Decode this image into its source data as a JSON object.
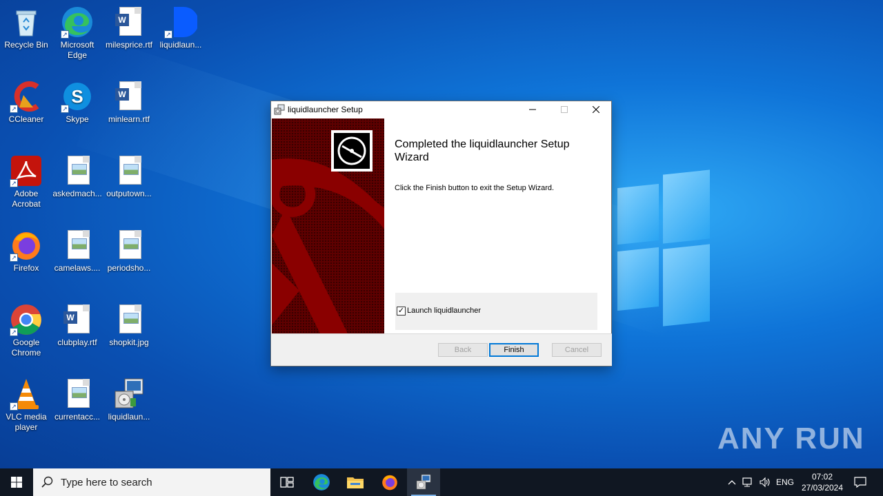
{
  "desktop": {
    "icons": [
      {
        "label": "Recycle Bin"
      },
      {
        "label": "Microsoft Edge"
      },
      {
        "label": "milesprice.rtf"
      },
      {
        "label": "liquidlaun..."
      },
      {
        "label": "CCleaner"
      },
      {
        "label": "Skype"
      },
      {
        "label": "minlearn.rtf"
      },
      {
        "label": "Adobe Acrobat"
      },
      {
        "label": "askedmach..."
      },
      {
        "label": "outputown..."
      },
      {
        "label": "Firefox"
      },
      {
        "label": "camelaws...."
      },
      {
        "label": "periodsho..."
      },
      {
        "label": "Google Chrome"
      },
      {
        "label": "clubplay.rtf"
      },
      {
        "label": "shopkit.jpg"
      },
      {
        "label": "VLC media player"
      },
      {
        "label": "currentacc..."
      },
      {
        "label": "liquidlaun..."
      }
    ]
  },
  "dialog": {
    "title": "liquidlauncher Setup",
    "heading": "Completed the liquidlauncher Setup Wizard",
    "message": "Click the Finish button to exit the Setup Wizard.",
    "launch_label": "Launch liquidlauncher",
    "launch_checked": true,
    "buttons": {
      "back": "Back",
      "finish": "Finish",
      "cancel": "Cancel"
    },
    "banner_color": "#7b0000"
  },
  "watermark": "ANY RUN",
  "taskbar": {
    "search_placeholder": "Type here to search",
    "language": "ENG",
    "time": "07:02",
    "date": "27/03/2024"
  }
}
